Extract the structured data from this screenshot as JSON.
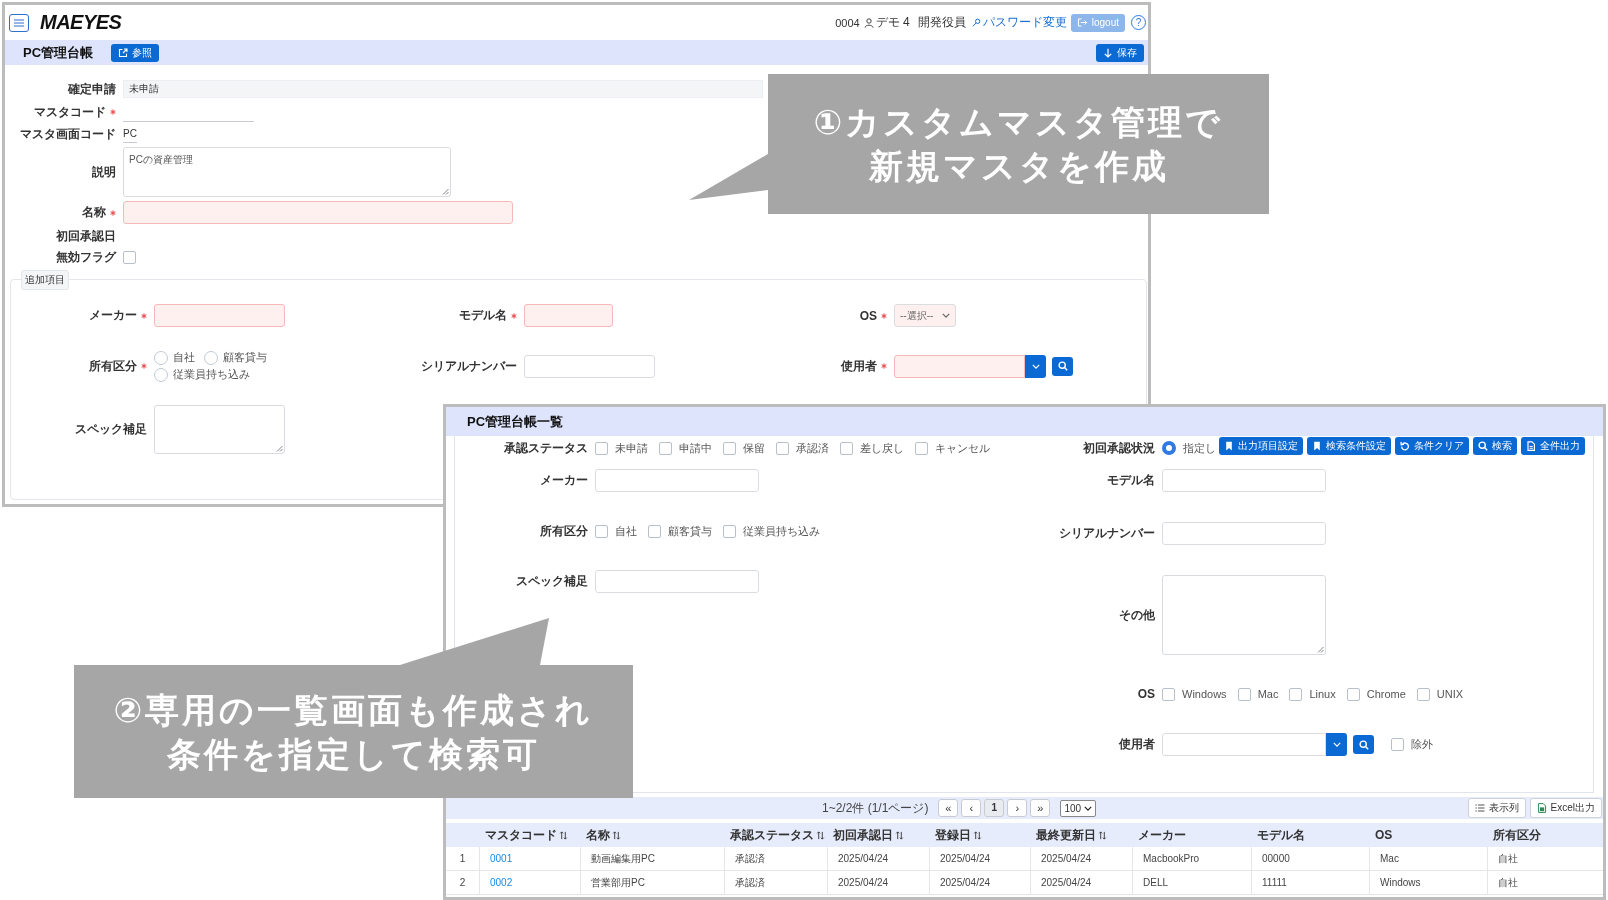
{
  "main_window": {
    "header": {
      "logo": "MAEYES",
      "user_code": "0004",
      "user_name": "デモ 4",
      "role": "開発役員",
      "password_link": "パスワード変更",
      "logout_button": "logout",
      "help_button": "?"
    },
    "title_bar": {
      "title": "PC管理台帳",
      "reference_button": "参照",
      "save_button": "保存"
    },
    "form": [
      {
        "kind": "readonly",
        "label": "確定申請",
        "value": "未申請"
      },
      {
        "kind": "underline",
        "label": "マスタコード",
        "required": true
      },
      {
        "kind": "underline",
        "label": "マスタ画面コード",
        "value": "PC"
      },
      {
        "kind": "textarea",
        "label": "説明",
        "value": "PCの資産管理"
      },
      {
        "kind": "input",
        "label": "名称",
        "required": true
      },
      {
        "kind": "plain",
        "label": "初回承認日"
      },
      {
        "kind": "checkbox",
        "label": "無効フラグ",
        "checked": false
      }
    ],
    "additional_section": {
      "legend": "追加項目",
      "rows": [
        [
          {
            "kind": "input",
            "label": "メーカー",
            "required": true
          },
          {
            "kind": "input",
            "label": "モデル名",
            "required": true
          },
          {
            "kind": "select",
            "label": "OS",
            "required": true,
            "value": "--選択--"
          }
        ],
        [
          {
            "kind": "radio",
            "label": "所有区分",
            "required": true,
            "options": [
              {
                "label": "自社",
                "selected": false
              },
              {
                "label": "顧客貸与",
                "selected": false
              },
              {
                "label": "従業員持ち込み",
                "selected": false
              }
            ]
          },
          {
            "kind": "input",
            "label": "シリアルナンバー"
          },
          {
            "kind": "lookup",
            "label": "使用者",
            "required": true
          }
        ],
        [
          {
            "kind": "textarea",
            "label": "スペック補足"
          }
        ]
      ]
    }
  },
  "list_window": {
    "title": "PC管理台帳一覧",
    "search_form": {
      "left": [
        {
          "kind": "checkboxes",
          "label": "承認ステータス",
          "options": [
            {
              "label": "未申請",
              "checked": false
            },
            {
              "label": "申請中",
              "checked": false
            },
            {
              "label": "保留",
              "checked": false
            },
            {
              "label": "承認済",
              "checked": false
            },
            {
              "label": "差し戻し",
              "checked": false
            },
            {
              "label": "キャンセル",
              "checked": false
            }
          ]
        },
        {
          "kind": "input",
          "label": "メーカー"
        },
        {
          "kind": "checkboxes",
          "label": "所有区分",
          "options": [
            {
              "label": "自社",
              "checked": false
            },
            {
              "label": "顧客貸与",
              "checked": false
            },
            {
              "label": "従業員持ち込み",
              "checked": false
            }
          ]
        },
        {
          "kind": "input",
          "label": "スペック補足"
        }
      ],
      "right": [
        {
          "kind": "radio",
          "label": "初回承認状況",
          "options": [
            {
              "label": "指定し",
              "selected": true
            }
          ]
        },
        {
          "kind": "input",
          "label": "モデル名"
        },
        {
          "kind": "input",
          "label": "シリアルナンバー"
        },
        {
          "kind": "textarea",
          "label": "その他"
        },
        {
          "kind": "checkboxes",
          "label": "OS",
          "options": [
            {
              "label": "Windows",
              "checked": false
            },
            {
              "label": "Mac",
              "checked": false
            },
            {
              "label": "Linux",
              "checked": false
            },
            {
              "label": "Chrome",
              "checked": false
            },
            {
              "label": "UNIX",
              "checked": false
            }
          ]
        },
        {
          "kind": "lookup",
          "label": "使用者",
          "exclude": {
            "label": "除外",
            "checked": false
          }
        }
      ]
    },
    "toolbar": [
      {
        "label": "出力項目設定",
        "kind": "bookmark"
      },
      {
        "label": "検索条件設定",
        "kind": "bookmark"
      },
      {
        "label": "条件クリア",
        "kind": "reset"
      },
      {
        "label": "検索",
        "kind": "search"
      },
      {
        "label": "全件出力",
        "kind": "file"
      }
    ],
    "pagination": {
      "summary": "1~2/2件 (1/1ページ)",
      "first": "«",
      "previous": "‹",
      "pages": [
        {
          "label": "1",
          "selected": true
        }
      ],
      "next": "›",
      "last": "»",
      "page_size": "100"
    },
    "table_actions": [
      {
        "label": "表示列",
        "kind": "columns"
      },
      {
        "label": "Excel出力",
        "kind": "excel"
      }
    ],
    "table": {
      "columns": [
        {
          "label": "マスタコード",
          "sortable": true,
          "kind": "link"
        },
        {
          "label": "名称",
          "sortable": true,
          "kind": "text"
        },
        {
          "label": "承認ステータス",
          "sortable": true,
          "kind": "text"
        },
        {
          "label": "初回承認日",
          "sortable": true,
          "kind": "text"
        },
        {
          "label": "登録日",
          "sortable": true,
          "kind": "text"
        },
        {
          "label": "最終更新日",
          "sortable": true,
          "kind": "text"
        },
        {
          "label": "メーカー",
          "sortable": false,
          "kind": "text"
        },
        {
          "label": "モデル名",
          "sortable": false,
          "kind": "text"
        },
        {
          "label": "OS",
          "sortable": false,
          "kind": "text"
        },
        {
          "label": "所有区分",
          "sortable": false,
          "kind": "text"
        }
      ],
      "rows": [
        {
          "number": "1",
          "cells": [
            "0001",
            "動画編集用PC",
            "承認済",
            "2025/04/24",
            "2025/04/24",
            "2025/04/24",
            "MacbookPro",
            "00000",
            "Mac",
            "自社"
          ]
        },
        {
          "number": "2",
          "cells": [
            "0002",
            "営業部用PC",
            "承認済",
            "2025/04/24",
            "2025/04/24",
            "2025/04/24",
            "DELL",
            "11111",
            "Windows",
            "自社"
          ]
        }
      ]
    }
  },
  "callouts": [
    {
      "text": "①カスタムマスタ管理で新規マスタを作成"
    },
    {
      "text": "②専用の一覧画面も作成され条件を指定して検索可"
    }
  ]
}
